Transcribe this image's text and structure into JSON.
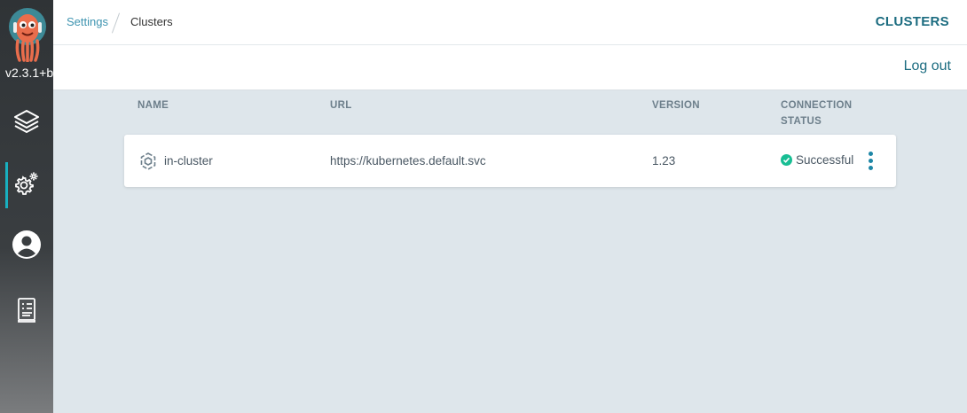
{
  "sidebar": {
    "version": "v2.3.1+b",
    "items": [
      {
        "name": "applications",
        "icon": "layers-icon"
      },
      {
        "name": "settings",
        "icon": "gear-icon",
        "active": true
      },
      {
        "name": "user-info",
        "icon": "user-circle-icon"
      },
      {
        "name": "docs",
        "icon": "docs-icon"
      }
    ]
  },
  "header": {
    "breadcrumb_parent": "Settings",
    "breadcrumb_current": "Clusters",
    "title": "CLUSTERS"
  },
  "toolbar": {
    "logout_label": "Log out"
  },
  "table": {
    "columns": [
      "NAME",
      "URL",
      "VERSION",
      "CONNECTION",
      "STATUS"
    ],
    "rows": [
      {
        "name": "in-cluster",
        "url": "https://kubernetes.default.svc",
        "version": "1.23",
        "status": "Successful"
      }
    ]
  },
  "colors": {
    "accent": "#1c6c80",
    "link": "#3e94b0",
    "success": "#18be94",
    "background": "#dee6eb"
  }
}
